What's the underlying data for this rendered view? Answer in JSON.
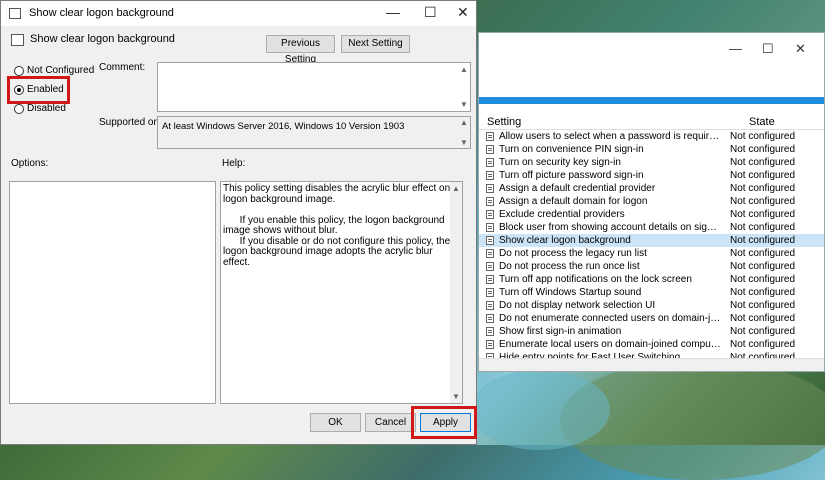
{
  "dialog": {
    "title": "Show clear logon background",
    "header_title": "Show clear logon background",
    "prev_button": "Previous Setting",
    "next_button": "Next Setting",
    "radios": {
      "not_configured": "Not Configured",
      "enabled": "Enabled",
      "disabled": "Disabled",
      "selected": "Enabled"
    },
    "comment_label": "Comment:",
    "comment_value": "",
    "supported_label": "Supported on:",
    "supported_value": "At least Windows Server 2016, Windows 10 Version 1903",
    "options_label": "Options:",
    "help_label": "Help:",
    "help_text": "This policy setting disables the acrylic blur effect on logon background image.\n\n      If you enable this policy, the logon background image shows without blur.\n      If you disable or do not configure this policy, the logon background image adopts the acrylic blur effect.",
    "ok_button": "OK",
    "cancel_button": "Cancel",
    "apply_button": "Apply",
    "highlight_color": "#d01818"
  },
  "background_window": {
    "col_setting": "Setting",
    "col_state": "State",
    "rows": [
      {
        "name": "Allow users to select when a password is required when resu...",
        "state": "Not configured"
      },
      {
        "name": "Turn on convenience PIN sign-in",
        "state": "Not configured"
      },
      {
        "name": "Turn on security key sign-in",
        "state": "Not configured"
      },
      {
        "name": "Turn off picture password sign-in",
        "state": "Not configured"
      },
      {
        "name": "Assign a default credential provider",
        "state": "Not configured"
      },
      {
        "name": "Assign a default domain for logon",
        "state": "Not configured"
      },
      {
        "name": "Exclude credential providers",
        "state": "Not configured"
      },
      {
        "name": "Block user from showing account details on sign-in",
        "state": "Not configured"
      },
      {
        "name": "Show clear logon background",
        "state": "Not configured",
        "selected": true
      },
      {
        "name": "Do not process the legacy run list",
        "state": "Not configured"
      },
      {
        "name": "Do not process the run once list",
        "state": "Not configured"
      },
      {
        "name": "Turn off app notifications on the lock screen",
        "state": "Not configured"
      },
      {
        "name": "Turn off Windows Startup sound",
        "state": "Not configured"
      },
      {
        "name": "Do not display network selection UI",
        "state": "Not configured"
      },
      {
        "name": "Do not enumerate connected users on domain-joined com...",
        "state": "Not configured"
      },
      {
        "name": "Show first sign-in animation",
        "state": "Not configured"
      },
      {
        "name": "Enumerate local users on domain-joined computers",
        "state": "Not configured"
      },
      {
        "name": "Hide entry points for Fast User Switching",
        "state": "Not configured"
      }
    ]
  }
}
